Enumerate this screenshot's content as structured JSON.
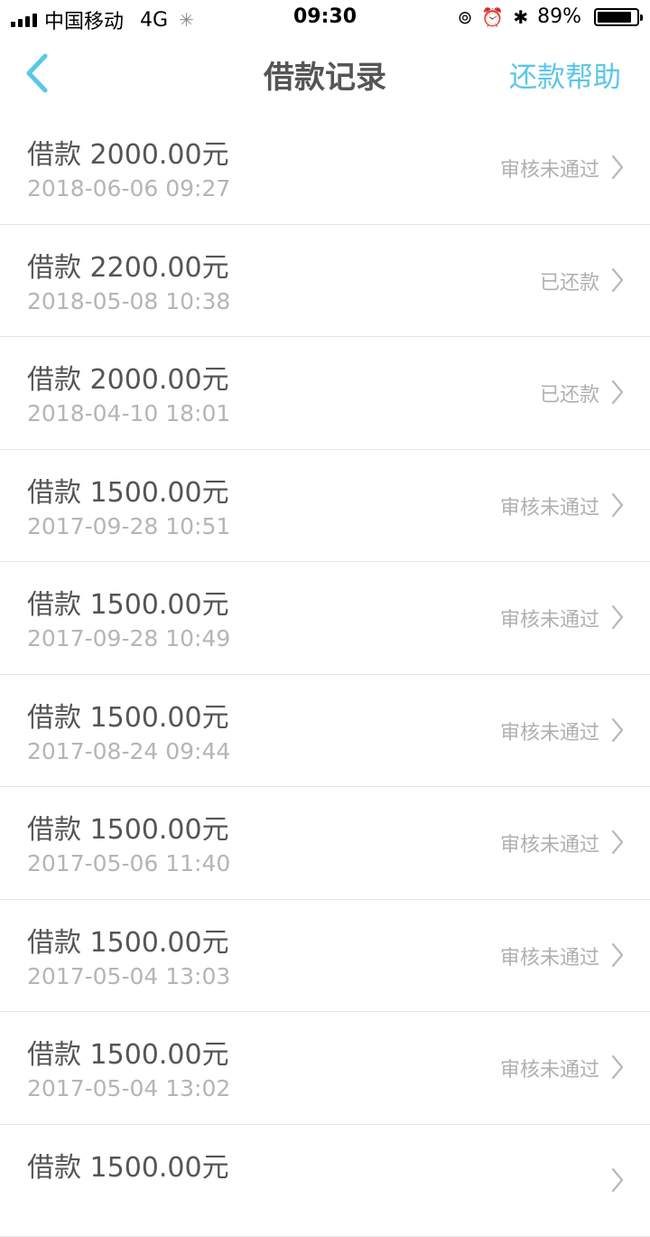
{
  "status_bar": {
    "carrier": "中国移动",
    "network": "4G",
    "time": "09:30",
    "battery_percent": "89%",
    "battery_level": 0.89
  },
  "nav": {
    "title": "借款记录",
    "right_action": "还款帮助",
    "accent_color": "#5bc6e8"
  },
  "records": [
    {
      "amount": "借款 2000.00元",
      "date": "2018-06-06 09:27",
      "status": "审核未通过"
    },
    {
      "amount": "借款 2200.00元",
      "date": "2018-05-08 10:38",
      "status": "已还款"
    },
    {
      "amount": "借款 2000.00元",
      "date": "2018-04-10 18:01",
      "status": "已还款"
    },
    {
      "amount": "借款 1500.00元",
      "date": "2017-09-28 10:51",
      "status": "审核未通过"
    },
    {
      "amount": "借款 1500.00元",
      "date": "2017-09-28 10:49",
      "status": "审核未通过"
    },
    {
      "amount": "借款 1500.00元",
      "date": "2017-08-24 09:44",
      "status": "审核未通过"
    },
    {
      "amount": "借款 1500.00元",
      "date": "2017-05-06 11:40",
      "status": "审核未通过"
    },
    {
      "amount": "借款 1500.00元",
      "date": "2017-05-04 13:03",
      "status": "审核未通过"
    },
    {
      "amount": "借款 1500.00元",
      "date": "2017-05-04 13:02",
      "status": "审核未通过"
    },
    {
      "amount": "借款 1500.00元",
      "date": "",
      "status": ""
    }
  ]
}
